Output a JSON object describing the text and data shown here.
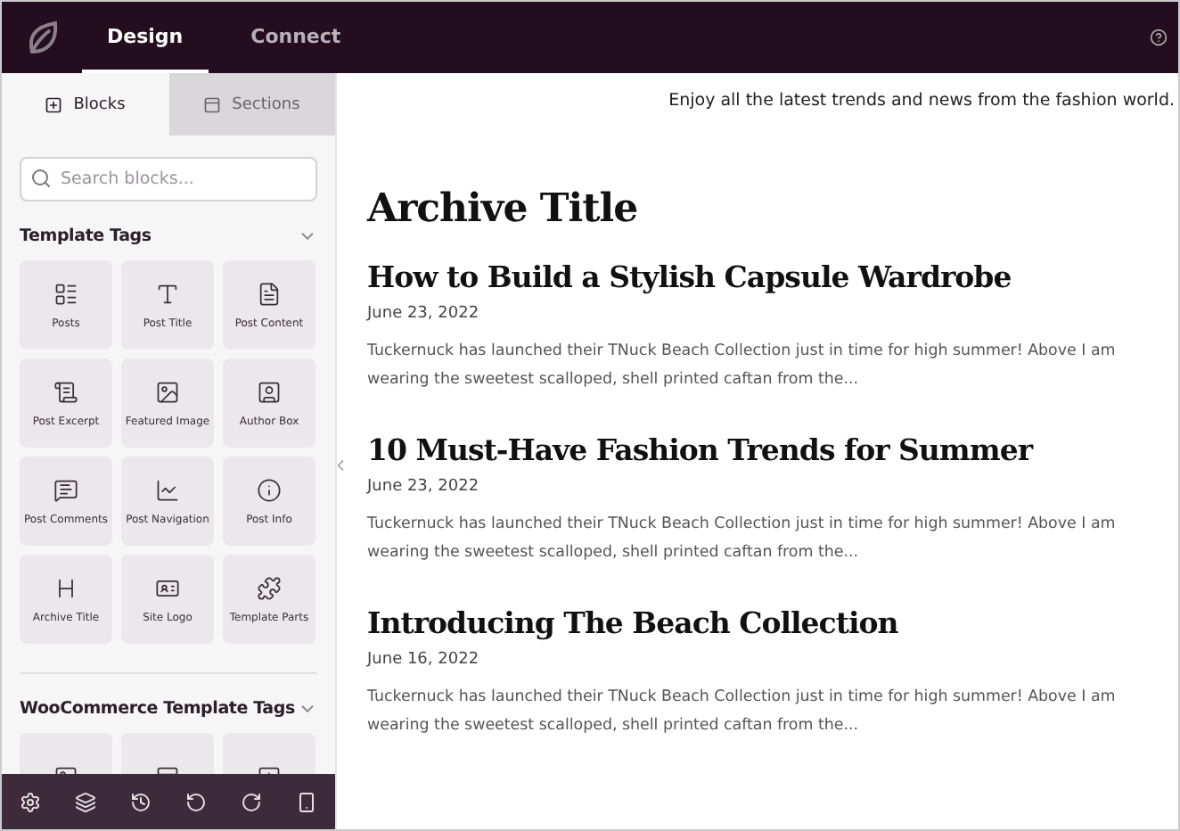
{
  "top_tabs": [
    {
      "label": "Design",
      "selected": true
    },
    {
      "label": "Connect",
      "selected": false
    }
  ],
  "sidebar": {
    "tabs": [
      {
        "label": "Blocks",
        "selected": true
      },
      {
        "label": "Sections",
        "selected": false
      }
    ],
    "search": {
      "placeholder": "Search blocks..."
    },
    "groups": [
      {
        "title": "Template Tags",
        "expanded": true,
        "blocks": [
          "Posts",
          "Post Title",
          "Post Content",
          "Post Excerpt",
          "Featured Image",
          "Author Box",
          "Post Comments",
          "Post Navigation",
          "Post Info",
          "Archive Title",
          "Site Logo",
          "Template Parts"
        ]
      },
      {
        "title": "WooCommerce Template Tags",
        "expanded": true
      }
    ]
  },
  "preview": {
    "tagline": "Enjoy all the latest trends and news from the fashion world.",
    "title": "Archive Title",
    "posts": [
      {
        "title": "How to Build a Stylish Capsule Wardrobe",
        "date": "June 23, 2022",
        "excerpt": "Tuckernuck has launched their TNuck Beach Collection just in time for high summer! Above I am wearing the sweetest scalloped, shell printed caftan from the..."
      },
      {
        "title": "10 Must-Have Fashion Trends for Summer",
        "date": "June 23, 2022",
        "excerpt": "Tuckernuck has launched their TNuck Beach Collection just in time for high summer! Above I am wearing the sweetest scalloped, shell printed caftan from the..."
      },
      {
        "title": "Introducing The Beach Collection",
        "date": "June 16, 2022",
        "excerpt": "Tuckernuck has launched their TNuck Beach Collection just in time for high summer! Above I am wearing the sweetest scalloped, shell printed caftan from the..."
      }
    ]
  }
}
